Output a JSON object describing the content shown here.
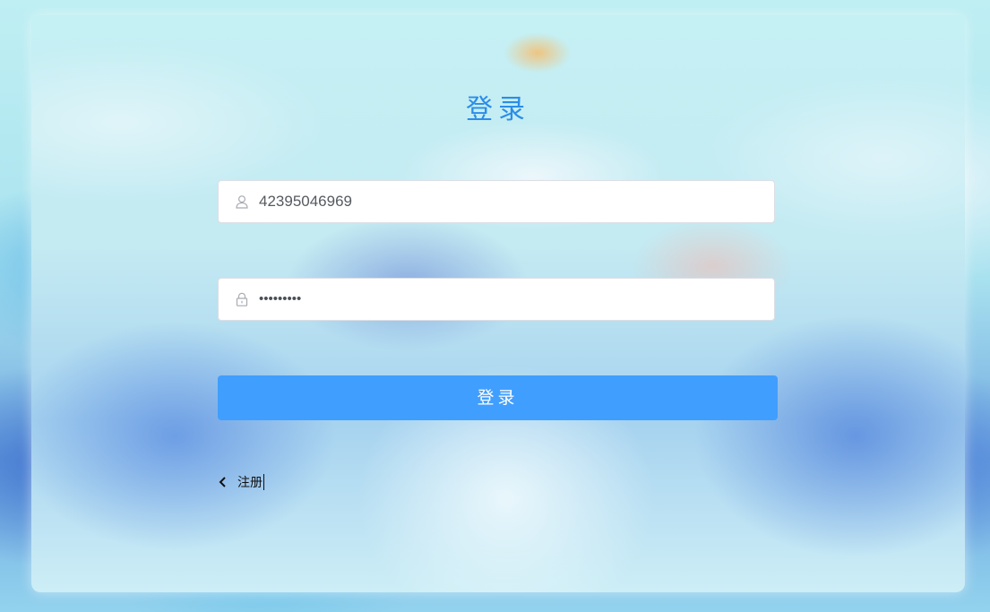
{
  "login": {
    "title": "登录",
    "username": {
      "icon": "user-icon",
      "value": "42395046969"
    },
    "password": {
      "icon": "lock-icon",
      "value": "•••••••••"
    },
    "submit_label": "登录",
    "register_link": {
      "icon": "chevron-left-icon",
      "label": "注册"
    }
  },
  "colors": {
    "accent": "#409eff",
    "title": "#2b8de8",
    "input_border": "#dcdfe6"
  }
}
